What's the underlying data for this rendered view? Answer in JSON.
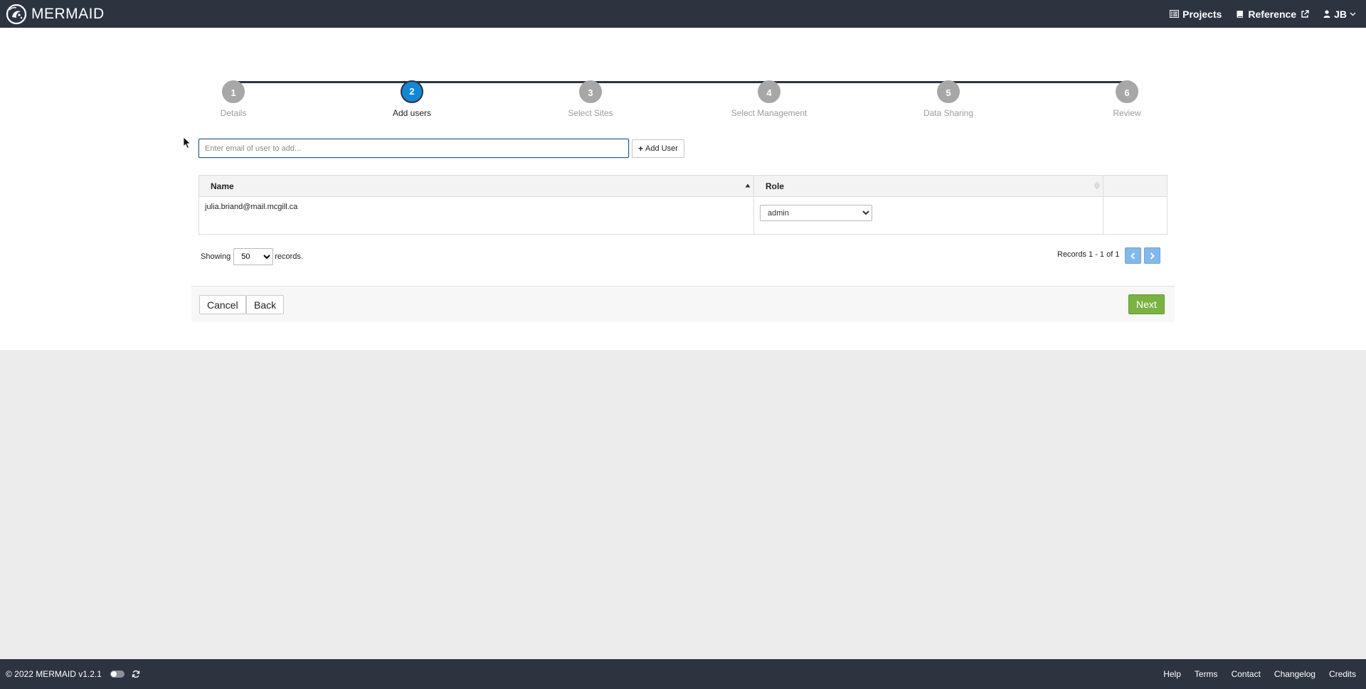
{
  "app": {
    "name": "MERMAID"
  },
  "nav": {
    "projects": "Projects",
    "reference": "Reference",
    "user": "JB"
  },
  "steps": [
    {
      "number": "1",
      "label": "Details"
    },
    {
      "number": "2",
      "label": "Add users"
    },
    {
      "number": "3",
      "label": "Select Sites"
    },
    {
      "number": "4",
      "label": "Select Management"
    },
    {
      "number": "5",
      "label": "Data Sharing"
    },
    {
      "number": "6",
      "label": "Review"
    }
  ],
  "active_step": 2,
  "add_user": {
    "placeholder": "Enter email of user to add...",
    "button_label": "Add User"
  },
  "table": {
    "headers": {
      "name": "Name",
      "role": "Role"
    },
    "rows": [
      {
        "name": "julia.briand@mail.mcgill.ca",
        "role": "admin"
      }
    ]
  },
  "pagination": {
    "showing_prefix": "Showing",
    "page_size": "50",
    "showing_suffix": "records.",
    "records_text": "Records 1 - 1 of 1"
  },
  "actions": {
    "cancel": "Cancel",
    "back": "Back",
    "next": "Next"
  },
  "footer": {
    "copyright": "© 2022 MERMAID v1.2.1",
    "links": [
      "Help",
      "Terms",
      "Contact",
      "Changelog",
      "Credits"
    ]
  },
  "colors": {
    "topbar": "#2c3440",
    "active_step": "#1387d6",
    "next_button": "#7ab243",
    "pager": "#84b8ea"
  }
}
